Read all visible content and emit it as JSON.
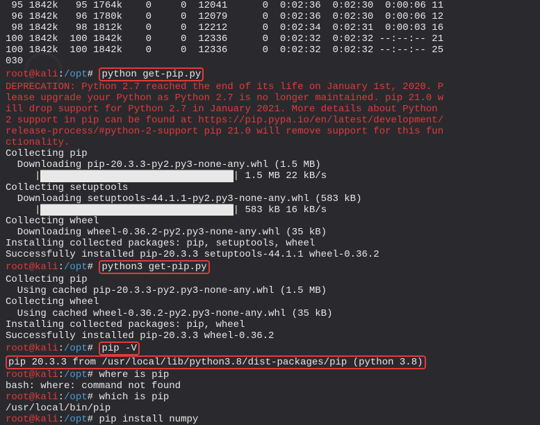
{
  "curl_lines": [
    " 95 1842k   95 1764k    0     0  12041      0  0:02:36  0:02:30  0:00:06 11",
    " 96 1842k   96 1780k    0     0  12079      0  0:02:36  0:02:30  0:00:06 12",
    " 98 1842k   98 1812k    0     0  12212      0  0:02:34  0:02:31  0:00:03 16",
    "100 1842k  100 1842k    0     0  12336      0  0:02:32  0:02:32 --:--:-- 21",
    "100 1842k  100 1842k    0     0  12336      0  0:02:32  0:02:32 --:--:-- 25",
    "030"
  ],
  "prompt": {
    "hostname": "root@kali",
    "sep": ":",
    "path": "/opt",
    "marker": "#"
  },
  "commands": {
    "python_getpip": "python get-pip.py",
    "python3_getpip": "python3 get-pip.py",
    "pip_v": "pip -V",
    "where_pip": "where is pip",
    "which_pip": "which is pip",
    "pip_install_numpy": "pip install numpy"
  },
  "deprecation": "DEPRECATION: Python 2.7 reached the end of its life on January 1st, 2020. Please upgrade your Python as Python 2.7 is no longer maintained. pip 21.0 will drop support for Python 2.7 in January 2021. More details about Python 2 support in pip can be found at https://pip.pypa.io/en/latest/development/release-process/#python-2-support pip 21.0 will remove support for this functionality.",
  "deprecation_lines": [
    "DEPRECATION: Python 2.7 reached the end of its life on January 1st, 2020. P",
    "lease upgrade your Python as Python 2.7 is no longer maintained. pip 21.0 w",
    "ill drop support for Python 2.7 in January 2021. More details about Python ",
    "2 support in pip can be found at https://pip.pypa.io/en/latest/development/",
    "release-process/#python-2-support pip 21.0 will remove support for this fun",
    "ctionality."
  ],
  "run1": {
    "collecting_pip": "Collecting pip",
    "downloading_pip": "  Downloading pip-20.3.3-py2.py3-none-any.whl (1.5 MB)",
    "progress_pip": "| 1.5 MB 22 kB/s",
    "collecting_setuptools": "Collecting setuptools",
    "downloading_setuptools": "  Downloading setuptools-44.1.1-py2.py3-none-any.whl (583 kB)",
    "progress_setuptools": "| 583 kB 16 kB/s",
    "collecting_wheel": "Collecting wheel",
    "downloading_wheel": "  Downloading wheel-0.36.2-py2.py3-none-any.whl (35 kB)",
    "installing": "Installing collected packages: pip, setuptools, wheel",
    "success": "Successfully installed pip-20.3.3 setuptools-44.1.1 wheel-0.36.2"
  },
  "run2": {
    "collecting_pip": "Collecting pip",
    "cached_pip": "  Using cached pip-20.3.3-py2.py3-none-any.whl (1.5 MB)",
    "collecting_wheel": "Collecting wheel",
    "cached_wheel": "  Using cached wheel-0.36.2-py2.py3-none-any.whl (35 kB)",
    "installing": "Installing collected packages: pip, wheel",
    "success": "Successfully installed pip-20.3.3 wheel-0.36.2"
  },
  "pip_version_output": "pip 20.3.3 from /usr/local/lib/python3.8/dist-packages/pip (python 3.8)",
  "where_error": "bash: where: command not found",
  "which_output": "/usr/local/bin/pip",
  "progress_fill": "█████████████████████████████████"
}
